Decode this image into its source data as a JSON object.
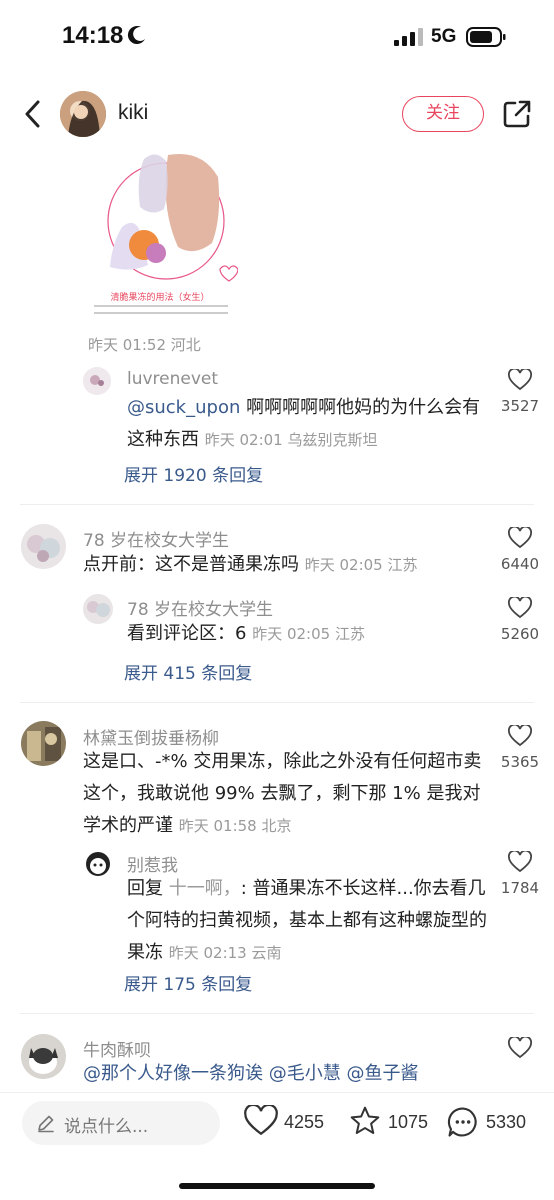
{
  "status_bar": {
    "time": "14:18",
    "network": "5G"
  },
  "header": {
    "username": "kiki",
    "follow_label": "关注"
  },
  "post": {
    "image_caption": "清脆果冻的用法（女生）",
    "meta": "昨天 01:52 河北"
  },
  "comments": [
    {
      "name": "luvrenevet",
      "mention": "@suck_upon",
      "text": " 啊啊啊啊啊他妈的为什么会有这种东西 ",
      "time": "昨天 02:01 乌兹别克斯坦",
      "likes": "3527",
      "expand": "展开 1920 条回复"
    },
    {
      "name": "78 岁在校女大学生",
      "text": "点开前：这不是普通果冻吗 ",
      "time": "昨天 02:05 江苏",
      "likes": "6440",
      "reply": {
        "name": "78 岁在校女大学生",
        "text": "看到评论区：6 ",
        "time": "昨天 02:05 江苏",
        "likes": "5260"
      },
      "expand": "展开 415 条回复"
    },
    {
      "name": "林黛玉倒拔垂杨柳",
      "text": "这是口、-*% 交用果冻，除此之外没有任何超市卖这个，我敢说他 99% 去飘了，剩下那 1% 是我对学术的严谨 ",
      "time": "昨天 01:58 北京",
      "likes": "5365",
      "reply": {
        "name": "别惹我",
        "prefix": "回复 ",
        "reply_to": "十一啊，",
        "text": ": 普通果冻不长这样...你去看几个阿特的扫黄视频，基本上都有这种螺旋型的果冻 ",
        "time": "昨天 02:13 云南",
        "likes": "1784"
      },
      "expand": "展开 175 条回复"
    },
    {
      "name": "牛肉酥呗",
      "text": "@那个人好像一条狗诶 @毛小慧 @鱼子酱"
    }
  ],
  "bottom_bar": {
    "placeholder": "说点什么...",
    "likes": "4255",
    "collects": "1075",
    "comments": "5330"
  },
  "colors": {
    "accent": "#e8465e",
    "link": "#3a5a8c"
  }
}
